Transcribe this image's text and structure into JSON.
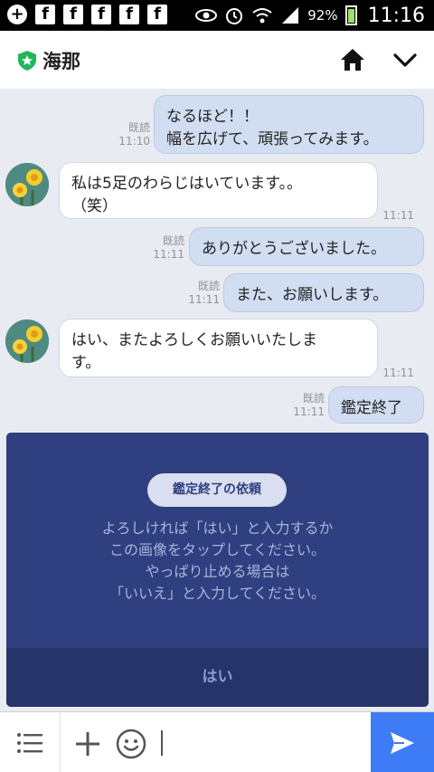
{
  "status_bar": {
    "battery": "92%",
    "time": "11:16"
  },
  "header": {
    "title": "海那"
  },
  "messages": [
    {
      "side": "out",
      "read": "既読",
      "time": "11:10",
      "lines": [
        "なるほど！！",
        "幅を広げて、頑張ってみます。"
      ]
    },
    {
      "side": "in",
      "time": "11:11",
      "lines": [
        "私は5足のわらじはいています。。",
        "（笑）"
      ]
    },
    {
      "side": "out",
      "read": "既読",
      "time": "11:11",
      "lines": [
        "ありがとうございました。"
      ]
    },
    {
      "side": "out",
      "read": "既読",
      "time": "11:11",
      "lines": [
        "また、お願いします。"
      ]
    },
    {
      "side": "in",
      "time": "11:11",
      "lines": [
        "はい、またよろしくお願いいたしま",
        "す。"
      ]
    },
    {
      "side": "out",
      "read": "既読",
      "time": "11:11",
      "lines": [
        "鑑定終了"
      ]
    }
  ],
  "card": {
    "pill": "鑑定終了の依頼",
    "text_lines": [
      "よろしければ「はい」と入力するか",
      "この画像をタップしてください。",
      "やっぱり止める場合は",
      "「いいえ」と入力してください。"
    ],
    "yes_label": "はい"
  },
  "colors": {
    "accent": "#3d7cf5",
    "card": "#2f3f7f",
    "bubble_out": "#d1ddf1"
  }
}
